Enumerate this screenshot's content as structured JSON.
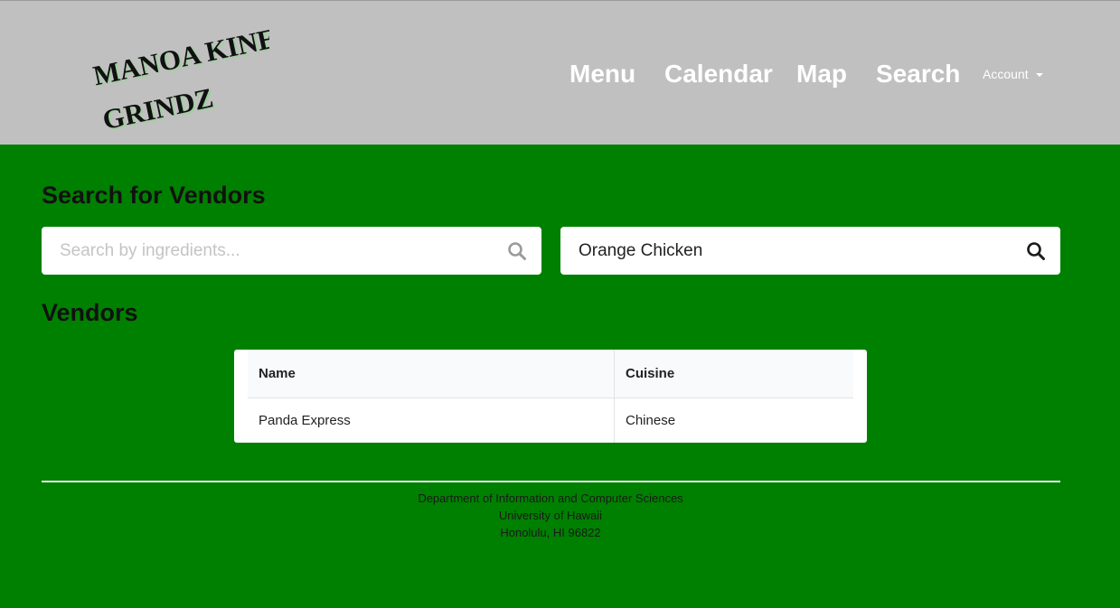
{
  "brand": {
    "logo_line1": "MANOA KINE",
    "logo_line2": "GRINDZ"
  },
  "nav": {
    "items": [
      "Menu",
      "Calendar",
      "Map",
      "Search"
    ],
    "account_label": "Account"
  },
  "colors": {
    "page_background": "#008000",
    "navbar_background": "#c0c0c0",
    "logo_text": "#111111",
    "logo_shadow": "#9fcf9f"
  },
  "main": {
    "title": "Search for Vendors",
    "ingredients_search": {
      "placeholder": "Search by ingredients...",
      "value": ""
    },
    "food_search": {
      "placeholder": "",
      "value": "Orange Chicken"
    },
    "vendors_title": "Vendors",
    "table": {
      "headers": [
        "Name",
        "Cuisine"
      ],
      "rows": [
        [
          "Panda Express",
          "Chinese"
        ]
      ]
    }
  },
  "footer": {
    "lines": [
      "Department of Information and Computer Sciences",
      "University of Hawaii",
      "Honolulu, HI 96822"
    ]
  },
  "icons": {
    "ingredients_search": "search-icon",
    "food_search": "search-icon",
    "account_caret": "caret-down-icon"
  }
}
